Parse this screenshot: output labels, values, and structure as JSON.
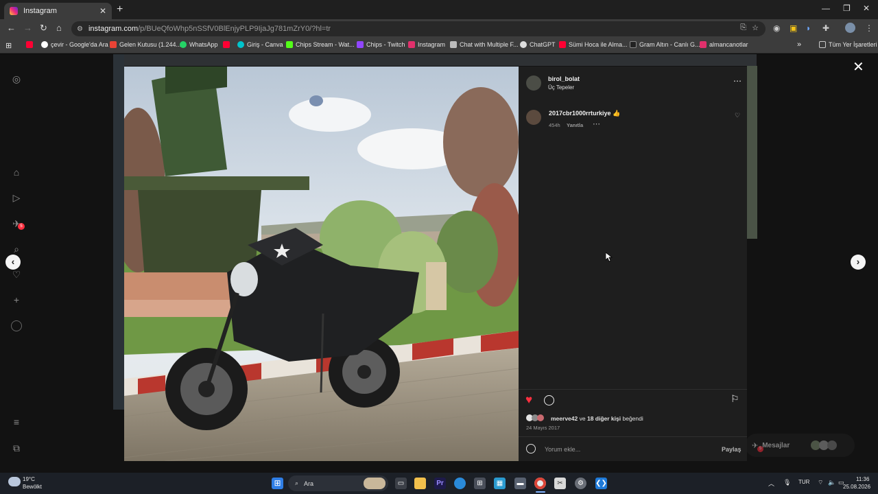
{
  "browser": {
    "tab_title": "Instagram",
    "url_host": "instagram.com",
    "url_path": "/p/BUeQfoWhp5nSSfV0BlEnjyPLP9IjaJg781mZrY0/?hl=tr",
    "bookmarks": [
      "",
      "çevir - Google'da Ara",
      "Gelen Kutusu (1.244...",
      "WhatsApp",
      "",
      "Giriş - Canva",
      "Chips Stream - Wat...",
      "Chips - Twitch",
      "Instagram",
      "Chat with Multiple F...",
      "ChatGPT",
      "Sümi Hoca ile Alma...",
      "Gram Altın - Canlı G...",
      "almancanotlar"
    ],
    "more_bookmarks": "»",
    "all_bookmarks": "Tüm Yer İşaretleri",
    "colors": {
      "tab_bg": "#3c3c3c",
      "toolbar_bg": "#3c3c3c",
      "omnibox_bg": "#282828"
    }
  },
  "sidebar": {
    "notification_count": "5"
  },
  "post": {
    "author": "birol_bolat",
    "location": "Üç Tepeler",
    "comment": {
      "author": "2017cbr1000rrturkiye",
      "emoji": "👍",
      "age": "454h",
      "reply_label": "Yanıtla"
    },
    "likes_user": "meerve42",
    "likes_rest_pre": "ve",
    "likes_count_text": "18 diğer kişi",
    "likes_suffix": "beğendi",
    "date": "24 Mayıs 2017",
    "comment_placeholder": "Yorum ekle...",
    "share_label": "Paylaş",
    "like_color": "#ff3040"
  },
  "messages": {
    "label": "Mesajlar",
    "badge": "5"
  },
  "taskbar": {
    "weather_temp": "19°C",
    "weather_desc": "Bewölkt",
    "search_label": "Ara",
    "language": "TUR",
    "time": "11:36",
    "date": "25.08.2026"
  }
}
